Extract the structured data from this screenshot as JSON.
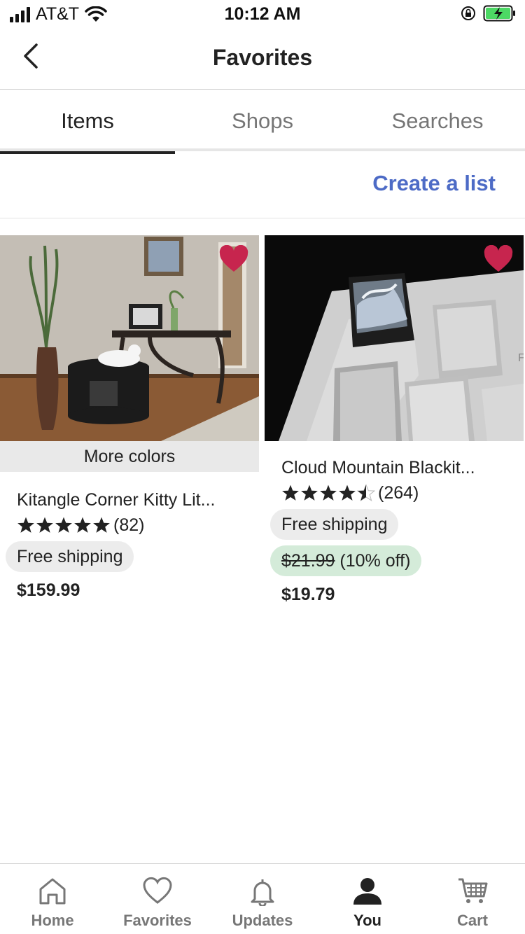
{
  "status_bar": {
    "carrier": "AT&T",
    "time": "10:12 AM"
  },
  "header": {
    "title": "Favorites"
  },
  "tabs": [
    {
      "label": "Items",
      "active": true
    },
    {
      "label": "Shops",
      "active": false
    },
    {
      "label": "Searches",
      "active": false
    }
  ],
  "actions": {
    "create_list": "Create a list"
  },
  "items": [
    {
      "more_colors": "More colors",
      "title": "Kitangle Corner Kitty Lit...",
      "rating": 5,
      "review_count": "(82)",
      "shipping": "Free shipping",
      "price": "$159.99"
    },
    {
      "title": "Cloud Mountain Blackit...",
      "rating": 4.5,
      "review_count": "(264)",
      "shipping": "Free shipping",
      "original_price": "$21.99",
      "discount": "(10% off)",
      "price": "$19.79"
    }
  ],
  "bottom_nav": [
    {
      "label": "Home",
      "icon": "home-icon"
    },
    {
      "label": "Favorites",
      "icon": "heart-icon"
    },
    {
      "label": "Updates",
      "icon": "bell-icon"
    },
    {
      "label": "You",
      "icon": "person-icon",
      "active": true
    },
    {
      "label": "Cart",
      "icon": "cart-icon"
    }
  ],
  "colors": {
    "accent_link": "#4d6bc6",
    "heart": "#c7254e",
    "sale_bg": "#d4ebd9"
  }
}
